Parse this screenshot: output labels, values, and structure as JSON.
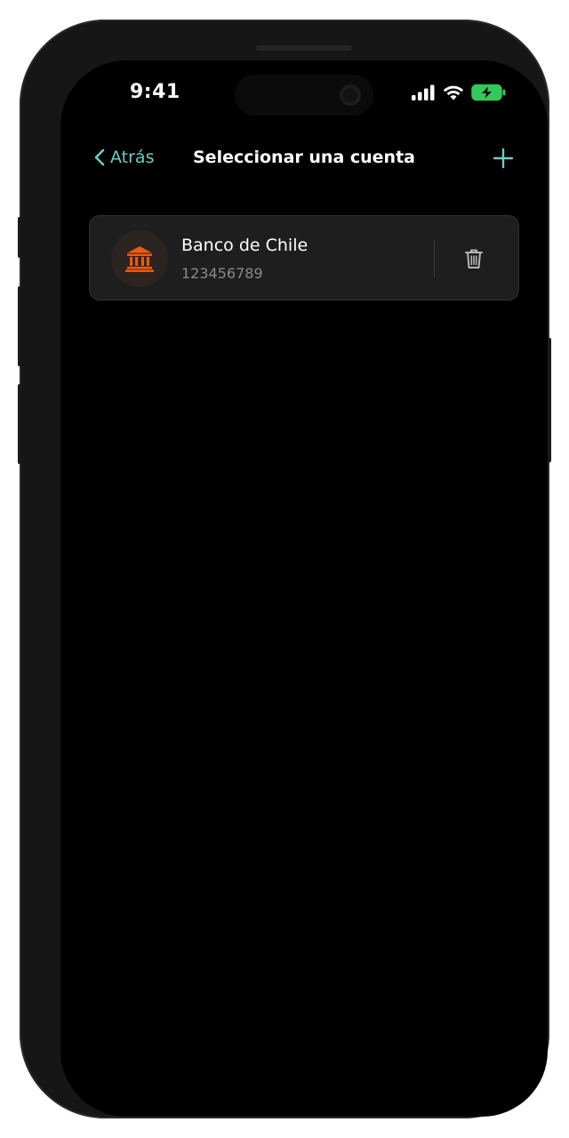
{
  "status_bar": {
    "time": "9:41",
    "icons": [
      "cellular-signal-icon",
      "wifi-icon",
      "battery-charging-icon"
    ],
    "battery_color": "#34c759"
  },
  "navbar": {
    "back_label": "Atrás",
    "title": "Seleccionar una cuenta",
    "add_icon": "plus-icon",
    "accent_color": "#6ecdc6"
  },
  "accounts": [
    {
      "name": "Banco de Chile",
      "number": "123456789",
      "icon": "bank-icon",
      "icon_color": "#e85b13",
      "action_icon": "trash-icon"
    }
  ]
}
